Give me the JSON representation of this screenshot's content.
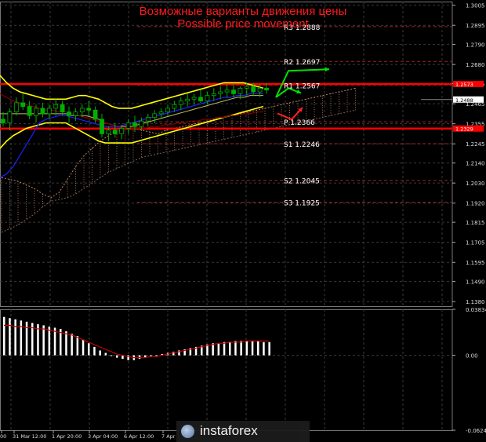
{
  "title_ru": "Возможные варианты движения цены",
  "title_en": "Possible price movement",
  "brand": "instaforex",
  "colors": {
    "background": "#000000",
    "grid": "#3a3a3a",
    "level_red": "#ff0000",
    "level_text": "#ffffff",
    "arrow_green": "#00e000",
    "arrow_red": "#ff2020",
    "bollinger": "#ffff00",
    "ma_dark": "#800000",
    "ma_blue": "#2020ff",
    "candle": "#00b000",
    "osc_bar": "#ffffff",
    "osc_signal": "#c00000"
  },
  "chart_data": [
    {
      "type": "candlestick",
      "ylim": [
        1.1355,
        1.3025
      ],
      "yticks": [
        "1.3005",
        "1.2895",
        "1.2790",
        "1.2680",
        "1.2575",
        "1.2465",
        "1.2355",
        "1.2245",
        "1.2140",
        "1.2030",
        "1.1920",
        "1.1815",
        "1.1705",
        "1.1595",
        "1.1490",
        "1.1380"
      ],
      "price_label": "1.2488",
      "current_price": 1.2488,
      "levels": [
        {
          "name": "R3",
          "value": 1.2888,
          "label": "R3 1.2888"
        },
        {
          "name": "R2",
          "value": 1.2697,
          "label": "R2 1.2697"
        },
        {
          "name": "R1",
          "value": 1.2567,
          "label": "R1 1.2567"
        },
        {
          "name": "P",
          "value": 1.2366,
          "label": "P 1.2366"
        },
        {
          "name": "S1",
          "value": 1.2246,
          "label": "S1 1.2246"
        },
        {
          "name": "S2",
          "value": 1.2045,
          "label": "S2 1.2045"
        },
        {
          "name": "S3",
          "value": 1.1925,
          "label": "S3 1.1925"
        }
      ],
      "red_lines": [
        {
          "value": 1.2573,
          "label": "1.2573"
        },
        {
          "value": 1.2329,
          "label": "1.2329"
        }
      ],
      "candles": [
        [
          1.238,
          1.242,
          1.234,
          1.236
        ],
        [
          1.236,
          1.244,
          1.232,
          1.242
        ],
        [
          1.242,
          1.25,
          1.24,
          1.247
        ],
        [
          1.247,
          1.252,
          1.243,
          1.245
        ],
        [
          1.245,
          1.248,
          1.238,
          1.24
        ],
        [
          1.24,
          1.246,
          1.236,
          1.244
        ],
        [
          1.244,
          1.247,
          1.239,
          1.241
        ],
        [
          1.241,
          1.246,
          1.238,
          1.244
        ],
        [
          1.244,
          1.249,
          1.24,
          1.246
        ],
        [
          1.246,
          1.248,
          1.24,
          1.242
        ],
        [
          1.242,
          1.245,
          1.236,
          1.24
        ],
        [
          1.24,
          1.244,
          1.237,
          1.242
        ],
        [
          1.242,
          1.246,
          1.239,
          1.244
        ],
        [
          1.244,
          1.248,
          1.24,
          1.243
        ],
        [
          1.243,
          1.245,
          1.236,
          1.238
        ],
        [
          1.238,
          1.241,
          1.228,
          1.23
        ],
        [
          1.23,
          1.234,
          1.226,
          1.232
        ],
        [
          1.232,
          1.236,
          1.228,
          1.23
        ],
        [
          1.23,
          1.235,
          1.227,
          1.233
        ],
        [
          1.233,
          1.238,
          1.23,
          1.236
        ],
        [
          1.236,
          1.24,
          1.231,
          1.234
        ],
        [
          1.234,
          1.239,
          1.232,
          1.237
        ],
        [
          1.237,
          1.241,
          1.234,
          1.239
        ],
        [
          1.239,
          1.243,
          1.236,
          1.241
        ],
        [
          1.241,
          1.244,
          1.238,
          1.242
        ],
        [
          1.242,
          1.246,
          1.24,
          1.244
        ],
        [
          1.244,
          1.248,
          1.242,
          1.246
        ],
        [
          1.246,
          1.25,
          1.243,
          1.248
        ],
        [
          1.248,
          1.252,
          1.245,
          1.249
        ],
        [
          1.249,
          1.252,
          1.246,
          1.25
        ],
        [
          1.25,
          1.254,
          1.247,
          1.248
        ],
        [
          1.248,
          1.253,
          1.246,
          1.251
        ],
        [
          1.251,
          1.255,
          1.248,
          1.252
        ],
        [
          1.252,
          1.256,
          1.249,
          1.253
        ],
        [
          1.253,
          1.257,
          1.25,
          1.254
        ],
        [
          1.254,
          1.257,
          1.25,
          1.252
        ],
        [
          1.252,
          1.256,
          1.249,
          1.255
        ],
        [
          1.255,
          1.258,
          1.251,
          1.256
        ],
        [
          1.256,
          1.258,
          1.251,
          1.253
        ],
        [
          1.253,
          1.257,
          1.25,
          1.255
        ],
        [
          1.255,
          1.258,
          1.252,
          1.254
        ]
      ],
      "bollinger_upper": [
        1.262,
        1.258,
        1.255,
        1.253,
        1.252,
        1.251,
        1.25,
        1.249,
        1.249,
        1.249,
        1.249,
        1.25,
        1.251,
        1.251,
        1.25,
        1.249,
        1.247,
        1.245,
        1.244,
        1.244,
        1.244,
        1.245,
        1.246,
        1.247,
        1.248,
        1.249,
        1.25,
        1.251,
        1.252,
        1.253,
        1.254,
        1.255,
        1.256,
        1.257,
        1.258,
        1.258,
        1.258,
        1.258,
        1.257,
        1.256,
        1.255
      ],
      "bollinger_mid": [
        1.241,
        1.241,
        1.241,
        1.241,
        1.241,
        1.241,
        1.241,
        1.241,
        1.241,
        1.241,
        1.241,
        1.24,
        1.24,
        1.24,
        1.239,
        1.238,
        1.236,
        1.235,
        1.234,
        1.234,
        1.234,
        1.235,
        1.236,
        1.237,
        1.238,
        1.239,
        1.24,
        1.241,
        1.242,
        1.243,
        1.244,
        1.245,
        1.246,
        1.247,
        1.248,
        1.249,
        1.25,
        1.25,
        1.251,
        1.251,
        1.251
      ],
      "bollinger_lower": [
        1.222,
        1.226,
        1.229,
        1.231,
        1.233,
        1.234,
        1.235,
        1.236,
        1.236,
        1.236,
        1.236,
        1.234,
        1.232,
        1.23,
        1.228,
        1.226,
        1.225,
        1.225,
        1.225,
        1.225,
        1.225,
        1.226,
        1.227,
        1.228,
        1.229,
        1.23,
        1.231,
        1.232,
        1.233,
        1.234,
        1.235,
        1.236,
        1.237,
        1.238,
        1.239,
        1.24,
        1.241,
        1.242,
        1.243,
        1.244,
        1.245
      ],
      "ma_dark": [
        1.252,
        1.25,
        1.248,
        1.247,
        1.246,
        1.245,
        1.244,
        1.243,
        1.243,
        1.242,
        1.242,
        1.241,
        1.24,
        1.239,
        1.238,
        1.237,
        1.236,
        1.235,
        1.234,
        1.233,
        1.233,
        1.233,
        1.233,
        1.234,
        1.234,
        1.235,
        1.235,
        1.236,
        1.236,
        1.237,
        1.237,
        1.238,
        1.238,
        1.239,
        1.239,
        1.24,
        1.24,
        1.241,
        1.241,
        1.242,
        1.242
      ],
      "ma_blue": [
        1.206,
        1.208,
        1.212,
        1.218,
        1.224,
        1.23,
        1.236,
        1.238,
        1.239,
        1.24,
        1.24,
        1.239,
        1.238,
        1.237,
        1.236,
        1.235,
        1.234,
        1.234,
        1.234,
        1.235,
        1.236,
        1.237,
        1.238,
        1.239,
        1.24,
        1.241,
        1.242,
        1.243,
        1.244,
        1.245,
        1.246,
        1.247,
        1.248,
        1.249,
        1.25,
        1.25,
        1.251,
        1.251,
        1.252,
        1.252,
        1.252
      ],
      "cloud_top": [
        1.206,
        1.205,
        1.204,
        1.202,
        1.2,
        1.197,
        1.195,
        1.198,
        1.205,
        1.212,
        1.218,
        1.222,
        1.226,
        1.229,
        1.231,
        1.233,
        1.233,
        1.232,
        1.231,
        1.23,
        1.232,
        1.233,
        1.234,
        1.235,
        1.236,
        1.237,
        1.238,
        1.239,
        1.24,
        1.241,
        1.242,
        1.243,
        1.244,
        1.245,
        1.246,
        1.247,
        1.248,
        1.249,
        1.25,
        1.251,
        1.252,
        1.253,
        1.254,
        1.255
      ],
      "cloud_bottom": [
        1.176,
        1.178,
        1.18,
        1.183,
        1.186,
        1.19,
        1.193,
        1.194,
        1.195,
        1.197,
        1.2,
        1.203,
        1.206,
        1.209,
        1.211,
        1.213,
        1.215,
        1.217,
        1.218,
        1.219,
        1.22,
        1.221,
        1.222,
        1.223,
        1.224,
        1.225,
        1.226,
        1.227,
        1.228,
        1.229,
        1.23,
        1.231,
        1.232,
        1.233,
        1.234,
        1.235,
        1.236,
        1.237,
        1.238,
        1.239,
        1.24,
        1.241,
        1.242,
        1.243
      ]
    },
    {
      "type": "bar",
      "name": "oscillator",
      "ylim": [
        -0.06247,
        0.03834
      ],
      "yticks": [
        "0.03834",
        "0.00",
        "-0.06247"
      ],
      "values": [
        0.032,
        0.031,
        0.03,
        0.029,
        0.028,
        0.027,
        0.026,
        0.025,
        0.024,
        0.023,
        0.022,
        0.02,
        0.018,
        0.016,
        0.013,
        0.01,
        0.007,
        0.004,
        0.002,
        0.0,
        -0.002,
        -0.003,
        -0.004,
        -0.004,
        -0.003,
        -0.002,
        -0.001,
        0.0,
        0.001,
        0.002,
        0.003,
        0.004,
        0.005,
        0.006,
        0.007,
        0.008,
        0.009,
        0.01,
        0.01,
        0.011,
        0.011,
        0.012,
        0.012,
        0.012,
        0.012,
        0.012,
        0.011,
        0.011
      ],
      "signal": [
        0.025,
        0.025,
        0.024,
        0.024,
        0.023,
        0.023,
        0.022,
        0.022,
        0.021,
        0.02,
        0.019,
        0.018,
        0.017,
        0.015,
        0.013,
        0.011,
        0.009,
        0.007,
        0.005,
        0.003,
        0.001,
        0.0,
        -0.001,
        -0.002,
        -0.002,
        -0.002,
        -0.001,
        -0.001,
        0.0,
        0.001,
        0.002,
        0.003,
        0.004,
        0.005,
        0.006,
        0.007,
        0.008,
        0.009,
        0.01,
        0.01,
        0.011,
        0.011,
        0.011,
        0.012,
        0.012,
        0.012,
        0.012,
        0.012
      ]
    }
  ],
  "x_axis": {
    "ticks": [
      "00",
      "31 Mar 12:00",
      "1 Apr 20:00",
      "3 Apr 04:00",
      "6 Apr 12:00",
      "7 Apr"
    ]
  }
}
